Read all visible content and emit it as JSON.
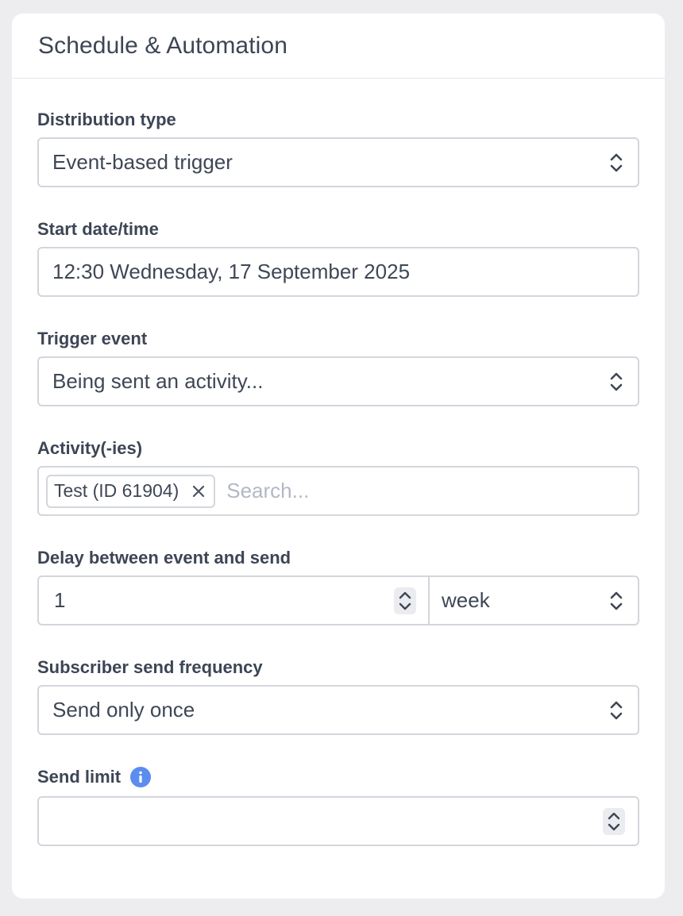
{
  "card": {
    "title": "Schedule & Automation"
  },
  "fields": {
    "distribution_type": {
      "label": "Distribution type",
      "value": "Event-based trigger"
    },
    "start_datetime": {
      "label": "Start date/time",
      "value": "12:30 Wednesday, 17 September 2025"
    },
    "trigger_event": {
      "label": "Trigger event",
      "value": "Being sent an activity..."
    },
    "activities": {
      "label": "Activity(-ies)",
      "chips": [
        {
          "label": "Test (ID 61904)"
        }
      ],
      "placeholder": "Search..."
    },
    "delay": {
      "label": "Delay between event and send",
      "amount": "1",
      "unit": "week"
    },
    "send_frequency": {
      "label": "Subscriber send frequency",
      "value": "Send only once"
    },
    "send_limit": {
      "label": "Send limit",
      "value": "",
      "info_icon": "info-icon"
    }
  },
  "colors": {
    "background": "#ededf0",
    "card": "#ffffff",
    "border": "#d3d6dd",
    "text": "#3f4756",
    "placeholder": "#b2b8c4",
    "info": "#5b8def"
  }
}
